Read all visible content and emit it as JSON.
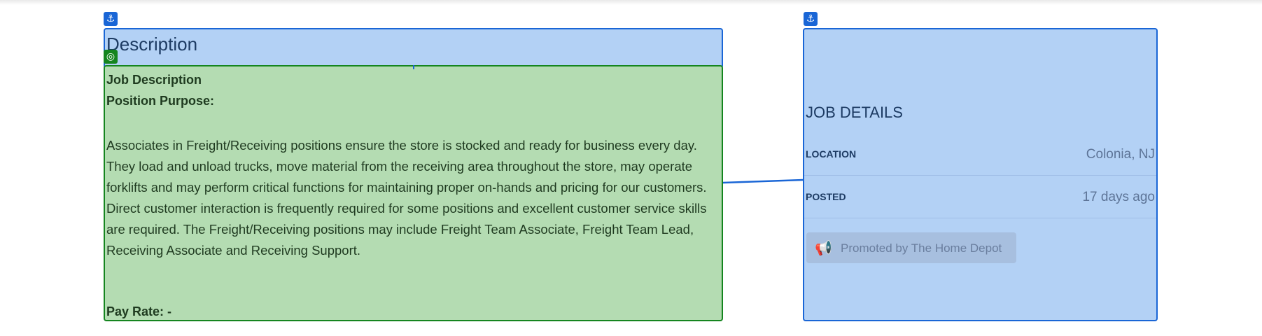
{
  "description_panel": {
    "title": "Description",
    "job_description_heading": "Job Description",
    "position_purpose_heading": "Position Purpose:",
    "paragraph": "Associates in Freight/Receiving positions ensure the store is stocked and ready for business every day. They load and unload trucks, move material from the receiving area throughout the store, may operate forklifts and may perform critical functions for maintaining proper on-hands and pricing for our customers. Direct customer interaction is frequently required for some positions and excellent customer service skills are required. The Freight/Receiving positions may include Freight Team Associate, Freight Team Lead, Receiving Associate and Receiving Support.",
    "pay_rate": "Pay Rate: -"
  },
  "job_details": {
    "title": "JOB DETAILS",
    "rows": [
      {
        "label": "LOCATION",
        "value": "Colonia, NJ"
      },
      {
        "label": "POSTED",
        "value": "17 days ago"
      }
    ],
    "promoted_text": "Promoted by The Home Depot"
  },
  "icons": {
    "anchor": "anchor-icon",
    "target": "target-icon",
    "megaphone": "megaphone-icon"
  },
  "colors": {
    "overlay_blue": "#b3d1f5",
    "overlay_blue_border": "#1a66d6",
    "overlay_green": "#b4dcb2",
    "overlay_green_border": "#15851f"
  }
}
